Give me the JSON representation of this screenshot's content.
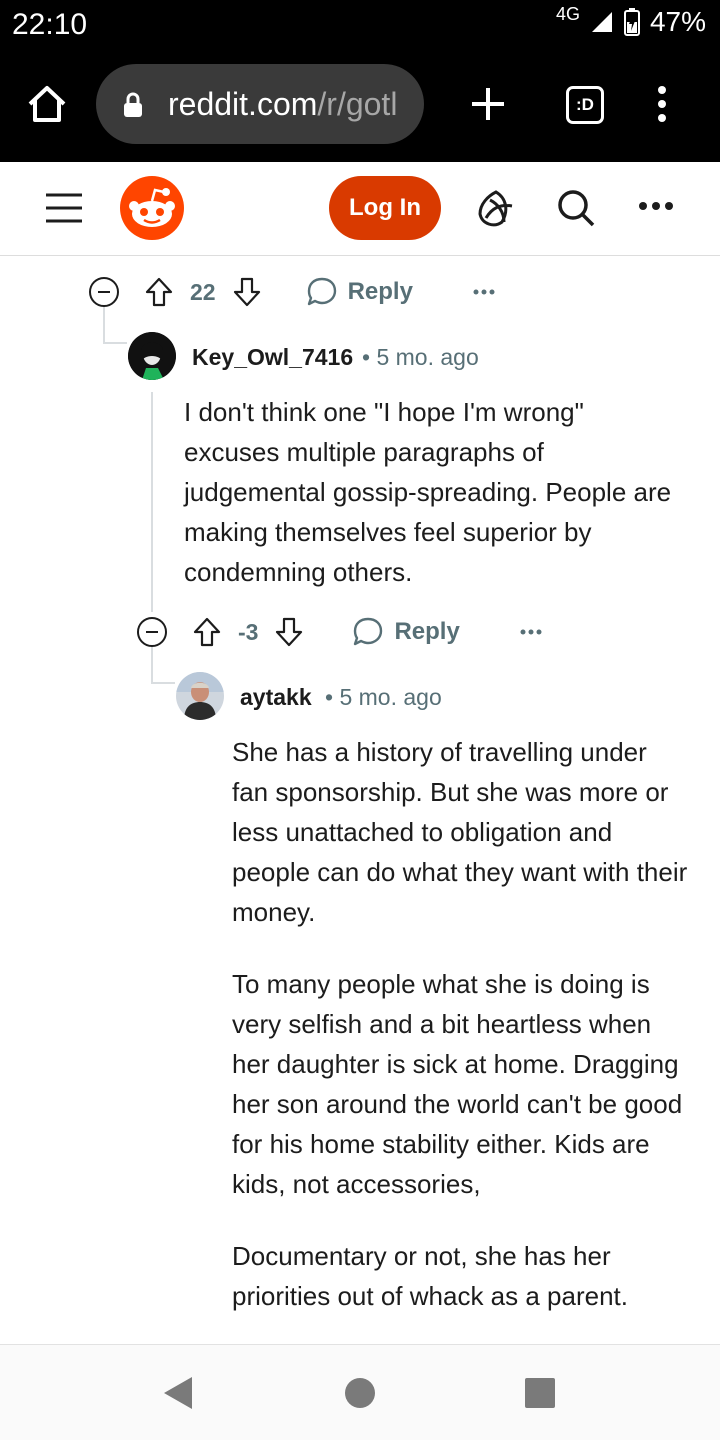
{
  "status_bar": {
    "time": "22:10",
    "network": "4G",
    "battery": "47%"
  },
  "browser": {
    "url_host": "reddit.com",
    "url_path": "/r/gotl",
    "tab_count_label": ":D"
  },
  "header": {
    "login_label": "Log In"
  },
  "comments": [
    {
      "vote_count": "22",
      "reply_label": "Reply"
    },
    {
      "username": "Key_Owl_7416",
      "age": "• 5 mo. ago",
      "body": [
        "I don't think one \"I hope I'm wrong\" excuses multiple paragraphs of judgemental gossip-spreading. People are making themselves feel superior by condemning others."
      ],
      "vote_count": "-3",
      "reply_label": "Reply"
    },
    {
      "username": "aytakk",
      "age": "• 5 mo. ago",
      "body": [
        "She has a history of travelling under fan sponsorship. But she was more or less unattached to obligation and people can do what they want with their money.",
        "To many people what she is doing is very selfish and a bit heartless when her daughter is sick at home. Dragging her son around the world can't be good for his home stability either. Kids are kids, not accessories,",
        "Documentary or not, she has her priorities out of whack as a parent."
      ]
    }
  ],
  "colors": {
    "brand": "#ff4500",
    "login": "#d93a00",
    "meta": "#576f76"
  }
}
